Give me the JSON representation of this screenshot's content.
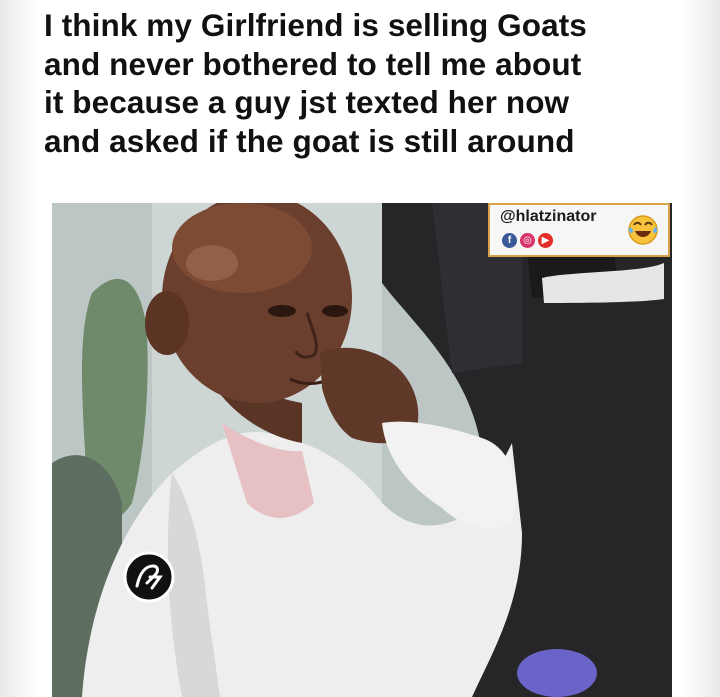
{
  "caption": {
    "line1": "I think my Girlfriend is selling Goats",
    "line2": "and never bothered to tell me about",
    "line3": "it because a guy jst texted her now",
    "line4": "and asked if the goat is still around"
  },
  "watermark": {
    "handle": "@hlatzinator",
    "social_icons": [
      "facebook-icon",
      "instagram-icon",
      "youtube-icon"
    ],
    "emoji": "tears-of-joy-emoji",
    "border_color": "#d8a24b"
  },
  "photo": {
    "logo": "circle-monogram-logo"
  }
}
